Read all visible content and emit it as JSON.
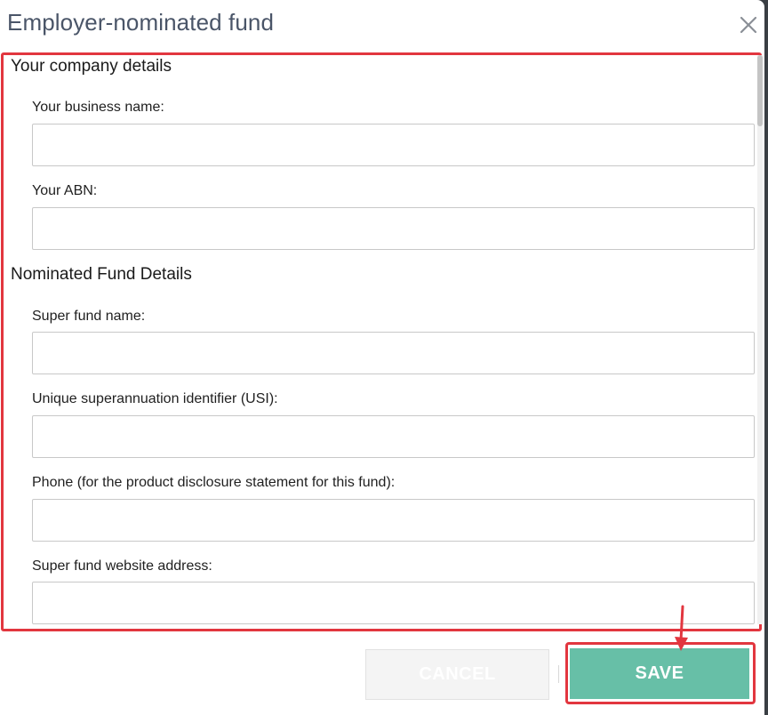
{
  "dialog": {
    "title": "Employer-nominated fund",
    "close_icon": "close-icon"
  },
  "company_section": {
    "title": "Your company details",
    "fields": [
      {
        "label": "Your business name:",
        "value": "",
        "placeholder": ""
      },
      {
        "label": "Your ABN:",
        "value": "",
        "placeholder": ""
      }
    ]
  },
  "fund_section": {
    "title": "Nominated Fund Details",
    "fields": [
      {
        "label": "Super fund name:",
        "value": "",
        "placeholder": ""
      },
      {
        "label": "Unique superannuation identifier (USI):",
        "value": "",
        "placeholder": ""
      },
      {
        "label": "Phone (for the product disclosure statement for this fund):",
        "value": "",
        "placeholder": ""
      },
      {
        "label": "Super fund website address:",
        "value": "",
        "placeholder": ""
      }
    ]
  },
  "actions": {
    "cancel_label": "CANCEL",
    "save_label": "SAVE"
  },
  "colors": {
    "title_text": "#4a5568",
    "save_button": "#67bfa7",
    "highlight": "#e2363f",
    "cancel_button": "#f4f4f4"
  }
}
